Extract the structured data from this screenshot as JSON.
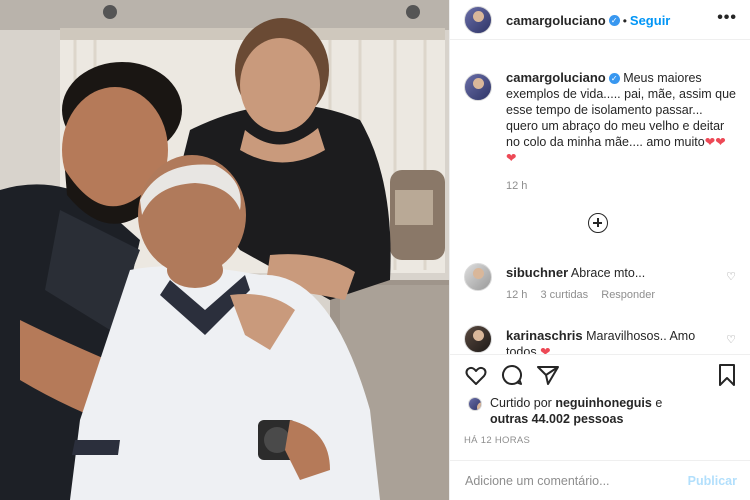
{
  "post": {
    "username": "camargoluciano",
    "follow_label": "Seguir",
    "dot": "•",
    "more_label": "•••",
    "verified_mark": "✓"
  },
  "caption": {
    "username": "camargoluciano",
    "text": "Meus maiores exemplos de vida..... pai, mãe, assim que esse tempo de isolamento passar... quero um abraço do meu velho e deitar no colo da minha mãe.... amo muito",
    "hearts": "❤❤❤",
    "time": "12 h"
  },
  "comments": [
    {
      "username": "sibuchner",
      "text": "Abrace mto...",
      "time": "12 h",
      "likes": "3 curtidas",
      "reply": "Responder"
    },
    {
      "username": "karinaschris",
      "text": "Maravilhosos.. Amo todos",
      "heart": "❤"
    }
  ],
  "likes": {
    "prefix": "Curtido por",
    "liker": "neguinhoneguis",
    "and": "e",
    "others": "outras 44.002 pessoas"
  },
  "timestamp": "HÁ 12 HORAS",
  "add_comment": {
    "placeholder": "Adicione um comentário...",
    "publish": "Publicar"
  },
  "colors": {
    "accent": "#0095f6",
    "heart": "#ed4956",
    "muted": "#8e8e8e",
    "publish_disabled": "#b2dffc"
  },
  "icons": [
    "heart-icon",
    "comment-icon",
    "share-icon",
    "bookmark-icon",
    "plus-circle-icon",
    "more-icon",
    "verified-icon"
  ]
}
